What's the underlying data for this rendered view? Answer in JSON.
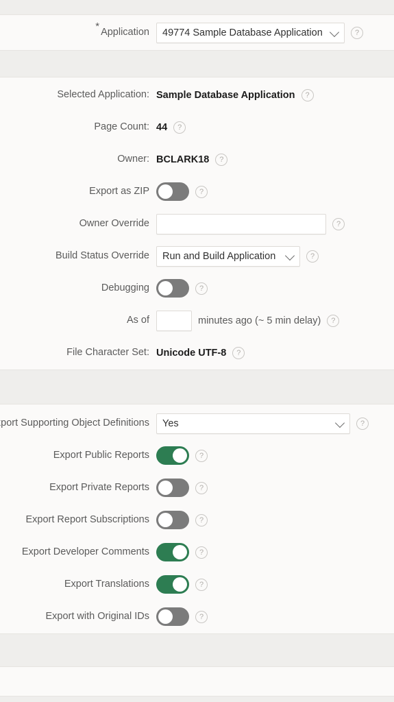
{
  "form": {
    "required_marker": "*",
    "help_glyph": "?",
    "application_row": {
      "label": "Application",
      "select_value": "49774 Sample Database Application",
      "required": true
    },
    "details": [
      {
        "name": "selected-application",
        "label": "Selected Application:",
        "type": "text",
        "value": "Sample Database Application"
      },
      {
        "name": "page-count",
        "label": "Page Count:",
        "type": "text",
        "value": "44"
      },
      {
        "name": "owner",
        "label": "Owner:",
        "type": "text",
        "value": "BCLARK18"
      },
      {
        "name": "export-as-zip",
        "label": "Export as ZIP",
        "type": "switch",
        "value": "off"
      },
      {
        "name": "owner-override",
        "label": "Owner Override",
        "type": "input",
        "value": ""
      },
      {
        "name": "build-status-override",
        "label": "Build Status Override",
        "type": "select",
        "value": "Run and Build Application"
      },
      {
        "name": "debugging",
        "label": "Debugging",
        "type": "switch",
        "value": "off"
      },
      {
        "name": "as-of",
        "label": "As of",
        "type": "input-suffix",
        "value": "",
        "suffix": "minutes ago (~ 5 min delay)"
      },
      {
        "name": "file-character-set",
        "label": "File Character Set:",
        "type": "text",
        "value": "Unicode UTF-8"
      }
    ],
    "export_options": [
      {
        "name": "export-supporting-object-definitions",
        "label": "Export Supporting Object Definitions",
        "type": "select",
        "value": "Yes"
      },
      {
        "name": "export-public-reports",
        "label": "Export Public Reports",
        "type": "switch",
        "value": "on"
      },
      {
        "name": "export-private-reports",
        "label": "Export Private Reports",
        "type": "switch",
        "value": "off"
      },
      {
        "name": "export-report-subscriptions",
        "label": "Export Report Subscriptions",
        "type": "switch",
        "value": "off"
      },
      {
        "name": "export-developer-comments",
        "label": "Export Developer Comments",
        "type": "switch",
        "value": "on"
      },
      {
        "name": "export-translations",
        "label": "Export Translations",
        "type": "switch",
        "value": "on"
      },
      {
        "name": "export-with-original-ids",
        "label": "Export with Original IDs",
        "type": "switch",
        "value": "off"
      }
    ]
  },
  "colors": {
    "switch_on": "#2d7d52",
    "switch_off": "#7b7b7b",
    "panel_bg": "#fbfaf9",
    "band_bg": "#efeeec",
    "label_text": "#5b5b5b",
    "value_text": "#1c1c1c"
  }
}
